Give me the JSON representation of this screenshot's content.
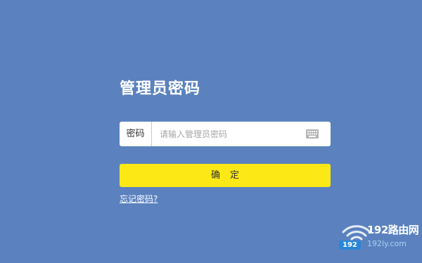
{
  "page": {
    "title": "管理员密码"
  },
  "password": {
    "label": "密码",
    "placeholder": "请输入管理员密码",
    "value": ""
  },
  "confirm_button": {
    "label": "确定"
  },
  "forgot_link": {
    "label": "忘记密码?"
  },
  "watermark": {
    "site_name": "192路由网",
    "badge": "192",
    "url": "192ly.com"
  },
  "icons": {
    "keyboard": "keyboard-icon",
    "wifi": "wifi-icon"
  },
  "colors": {
    "background": "#5b82bf",
    "button": "#fce814",
    "input_background": "#ffffff",
    "watermark_badge": "#2a86d6"
  }
}
